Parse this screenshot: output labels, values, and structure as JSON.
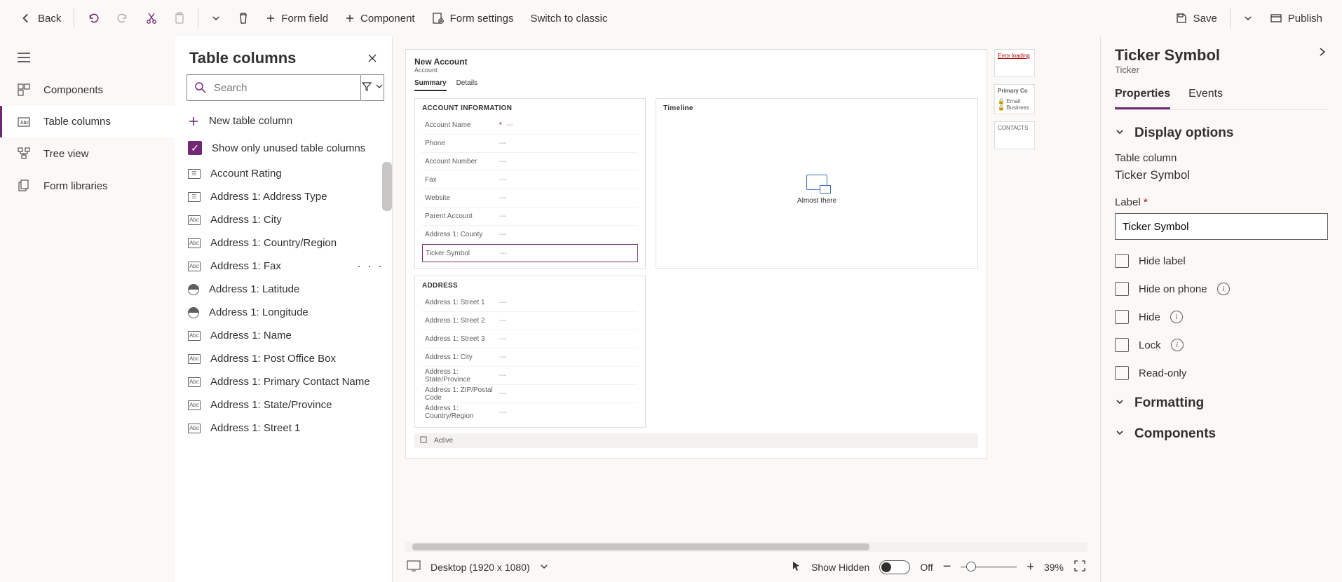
{
  "toolbar": {
    "back": "Back",
    "form_field": "Form field",
    "component": "Component",
    "form_settings": "Form settings",
    "switch_classic": "Switch to classic",
    "save": "Save",
    "publish": "Publish"
  },
  "leftrail": {
    "components": "Components",
    "table_columns": "Table columns",
    "tree_view": "Tree view",
    "form_libraries": "Form libraries"
  },
  "table_columns_panel": {
    "title": "Table columns",
    "search_placeholder": "Search",
    "new_column": "New table column",
    "show_unused": "Show only unused table columns",
    "items": [
      {
        "label": "Account Rating",
        "type": "opt"
      },
      {
        "label": "Address 1: Address Type",
        "type": "opt"
      },
      {
        "label": "Address 1: City",
        "type": "abc"
      },
      {
        "label": "Address 1: Country/Region",
        "type": "abc"
      },
      {
        "label": "Address 1: Fax",
        "type": "abc",
        "more": true
      },
      {
        "label": "Address 1: Latitude",
        "type": "globe"
      },
      {
        "label": "Address 1: Longitude",
        "type": "globe"
      },
      {
        "label": "Address 1: Name",
        "type": "abc"
      },
      {
        "label": "Address 1: Post Office Box",
        "type": "abc"
      },
      {
        "label": "Address 1: Primary Contact Name",
        "type": "abc"
      },
      {
        "label": "Address 1: State/Province",
        "type": "abc"
      },
      {
        "label": "Address 1: Street 1",
        "type": "abc"
      }
    ]
  },
  "canvas": {
    "form_title": "New Account",
    "form_entity": "Account",
    "tabs": [
      "Summary",
      "Details"
    ],
    "sections": {
      "account_info": {
        "header": "ACCOUNT INFORMATION",
        "fields": [
          {
            "label": "Account Name",
            "required": true,
            "value": "---"
          },
          {
            "label": "Phone",
            "value": "---"
          },
          {
            "label": "Account Number",
            "value": "---"
          },
          {
            "label": "Fax",
            "value": "---"
          },
          {
            "label": "Website",
            "value": "---"
          },
          {
            "label": "Parent Account",
            "value": "---"
          },
          {
            "label": "Address 1: County",
            "value": "---"
          },
          {
            "label": "Ticker Symbol",
            "value": "---",
            "selected": true
          }
        ]
      },
      "address": {
        "header": "ADDRESS",
        "fields": [
          {
            "label": "Address 1: Street 1",
            "value": "---"
          },
          {
            "label": "Address 1: Street 2",
            "value": "---"
          },
          {
            "label": "Address 1: Street 3",
            "value": "---"
          },
          {
            "label": "Address 1: City",
            "value": "---"
          },
          {
            "label": "Address 1: State/Province",
            "value": "---"
          },
          {
            "label": "Address 1: ZIP/Postal Code",
            "value": "---"
          },
          {
            "label": "Address 1: Country/Region",
            "value": "---"
          }
        ]
      },
      "timeline": {
        "header": "Timeline",
        "status": "Almost there"
      }
    },
    "right_cards": {
      "error": "Error loading",
      "primary": "Primary Co",
      "email": "Email",
      "business": "Business",
      "contacts": "CONTACTS"
    },
    "footer_status": "Active",
    "status_bar": {
      "viewport": "Desktop (1920 x 1080)",
      "show_hidden": "Show Hidden",
      "toggle_state": "Off",
      "zoom": "39%"
    }
  },
  "props": {
    "title": "Ticker Symbol",
    "subtitle": "Ticker",
    "tabs": {
      "properties": "Properties",
      "events": "Events"
    },
    "display_options": {
      "header": "Display options",
      "table_column_label": "Table column",
      "table_column_value": "Ticker Symbol",
      "label_label": "Label",
      "label_value": "Ticker Symbol",
      "hide_label": "Hide label",
      "hide_on_phone": "Hide on phone",
      "hide": "Hide",
      "lock": "Lock",
      "read_only": "Read-only"
    },
    "formatting": "Formatting",
    "components": "Components"
  }
}
